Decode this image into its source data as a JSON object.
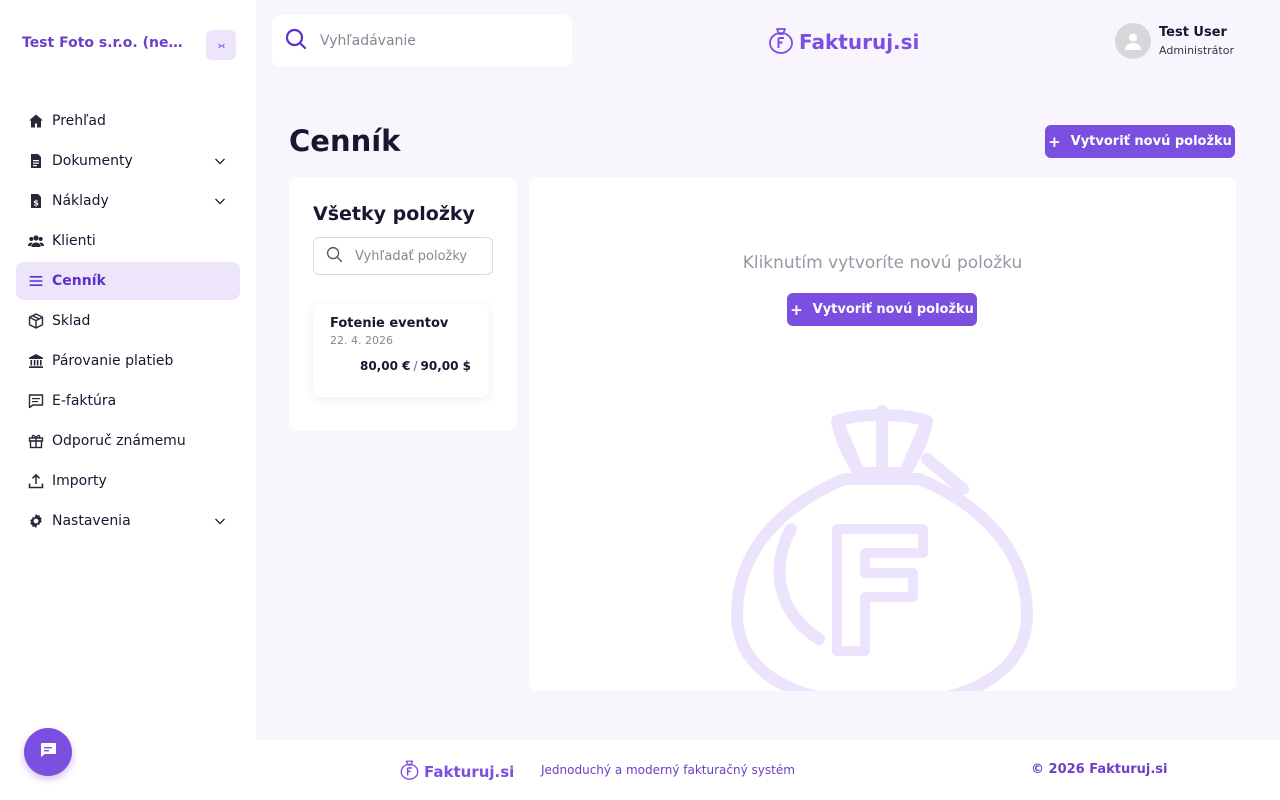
{
  "sidebar": {
    "company": "Test Foto s.r.o. (neplatiteľ DPH)",
    "collapse_label": "›‹",
    "items": [
      {
        "label": "Prehľad"
      },
      {
        "label": "Dokumenty"
      },
      {
        "label": "Náklady"
      },
      {
        "label": "Klienti"
      },
      {
        "label": "Cenník"
      },
      {
        "label": "Sklad"
      },
      {
        "label": "Párovanie platieb"
      },
      {
        "label": "E-faktúra"
      },
      {
        "label": "Odporuč známemu"
      },
      {
        "label": "Importy"
      },
      {
        "label": "Nastavenia"
      }
    ]
  },
  "header": {
    "search_placeholder": "Vyhľadávanie",
    "brand": "Fakturuj.si",
    "user_name": "Test User",
    "user_role": "Administrátor"
  },
  "page": {
    "title": "Cenník",
    "create_label": "Vytvoriť novú položku"
  },
  "items_panel": {
    "title": "Všetky položky",
    "search_placeholder": "Vyhľadať položky",
    "items": [
      {
        "name": "Fotenie eventov",
        "date": "22. 4. 2026",
        "price_eur": "80,00 €",
        "price_sep": "/",
        "price_usd": "90,00 $"
      }
    ]
  },
  "main_panel": {
    "empty_text": "Kliknutím vytvoríte novú položku",
    "create_label": "Vytvoriť novú položku"
  },
  "footer": {
    "brand": "Fakturuj.si",
    "tagline": "Jednoduchý a moderný fakturačný systém",
    "copyright": "© 2026 Fakturuj.si"
  },
  "colors": {
    "accent": "#7b4fe0",
    "active_bg": "#ede6fb",
    "page_bg": "#f8f5fd"
  }
}
